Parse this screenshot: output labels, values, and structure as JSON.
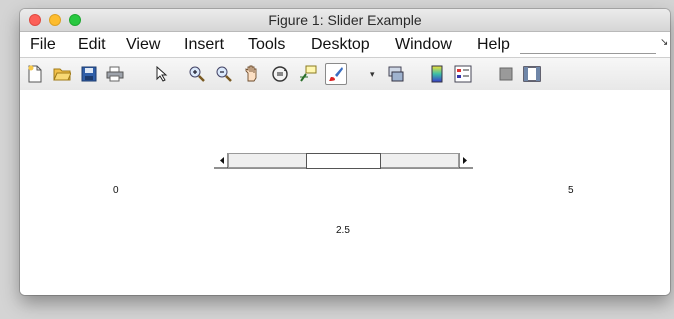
{
  "window": {
    "title": "Figure 1: Slider Example"
  },
  "menu": {
    "items": [
      "File",
      "Edit",
      "View",
      "Insert",
      "Tools",
      "Desktop",
      "Window",
      "Help"
    ]
  },
  "toolbar": {
    "tools": [
      "new-figure-icon",
      "open-folder-icon",
      "save-icon",
      "print-icon",
      "pointer-arrow-icon",
      "zoom-in-icon",
      "zoom-out-icon",
      "pan-hand-icon",
      "rotate-3d-icon",
      "data-cursor-icon",
      "brush-icon",
      "link-plot-icon",
      "colorbar-icon",
      "legend-icon",
      "hide-plot-tools-icon",
      "show-plot-tools-icon"
    ]
  },
  "slider": {
    "min_label": "0",
    "max_label": "5",
    "value_label": "2.5",
    "value_fraction": 0.5
  }
}
